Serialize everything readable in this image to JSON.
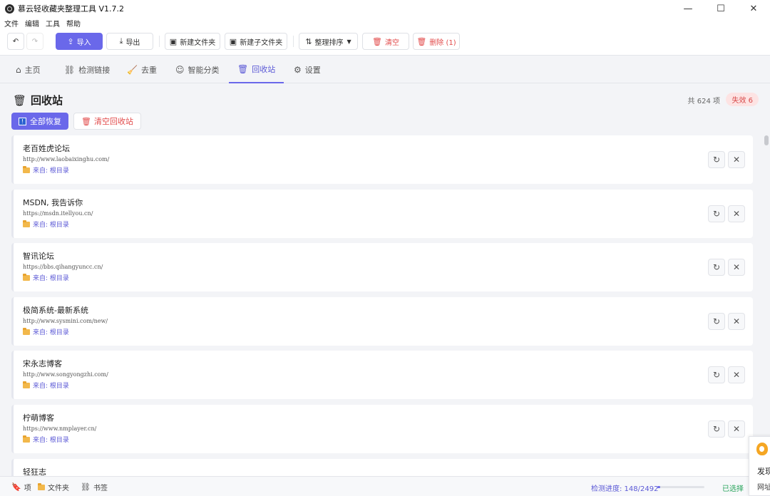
{
  "window": {
    "title": "慕云轻收藏夹整理工具 V1.7.2",
    "minimize": "—",
    "maximize": "☐",
    "close": "✕"
  },
  "menu": [
    "文件",
    "编辑",
    "工具",
    "帮助"
  ],
  "toolbar": {
    "undo": "↶",
    "redo": "↷",
    "import_label": "导入",
    "export_label": "导出",
    "new_folder_label": "新建文件夹",
    "new_subfolder_label": "新建子文件夹",
    "sort_label": "整理排序",
    "clear_label": "清空",
    "delete_label": "删除 (1)"
  },
  "tabs": [
    {
      "label": "主页",
      "icon": "home-icon"
    },
    {
      "label": "检测链接",
      "icon": "link-icon"
    },
    {
      "label": "去重",
      "icon": "broom-icon"
    },
    {
      "label": "智能分类",
      "icon": "robot-icon"
    },
    {
      "label": "回收站",
      "icon": "trash-icon",
      "active": true
    },
    {
      "label": "设置",
      "icon": "gear-icon"
    }
  ],
  "page": {
    "title": "回收站",
    "count": "共 624 项",
    "fail_badge": "失效 6",
    "restore_all_label": "全部恢复",
    "empty_bin_label": "清空回收站"
  },
  "items": [
    {
      "title": "老百姓虎论坛",
      "url": "http://www.laobaixinghu.com/",
      "source": "来自: 根目录"
    },
    {
      "title": "MSDN, 我告诉你",
      "url": "https://msdn.itellyou.cn/",
      "source": "来自: 根目录"
    },
    {
      "title": "智讯论坛",
      "url": "https://bbs.qihangyuncc.cn/",
      "source": "来自: 根目录"
    },
    {
      "title": "极简系统-最新系统",
      "url": "http://www.sysmini.com/new/",
      "source": "来自: 根目录"
    },
    {
      "title": "宋永志博客",
      "url": "http://www.songyongzhi.com/",
      "source": "来自: 根目录"
    },
    {
      "title": "柠萌博客",
      "url": "https://www.nmplayer.cn/",
      "source": "来自: 根目录"
    },
    {
      "title": "轻狂志",
      "url": "",
      "source": ""
    }
  ],
  "status": {
    "items_label": "项",
    "folders_label": "文件夹",
    "bookmarks_label": "书签",
    "progress_text": "检测进度: 148/2492",
    "progress_fraction": 0.059,
    "selected_text": "已选择"
  },
  "popup": {
    "line1": "发现",
    "line2": "网址"
  },
  "colors": {
    "accent": "#6a68ea",
    "danger": "#e24b4b",
    "success": "#27a35a"
  }
}
